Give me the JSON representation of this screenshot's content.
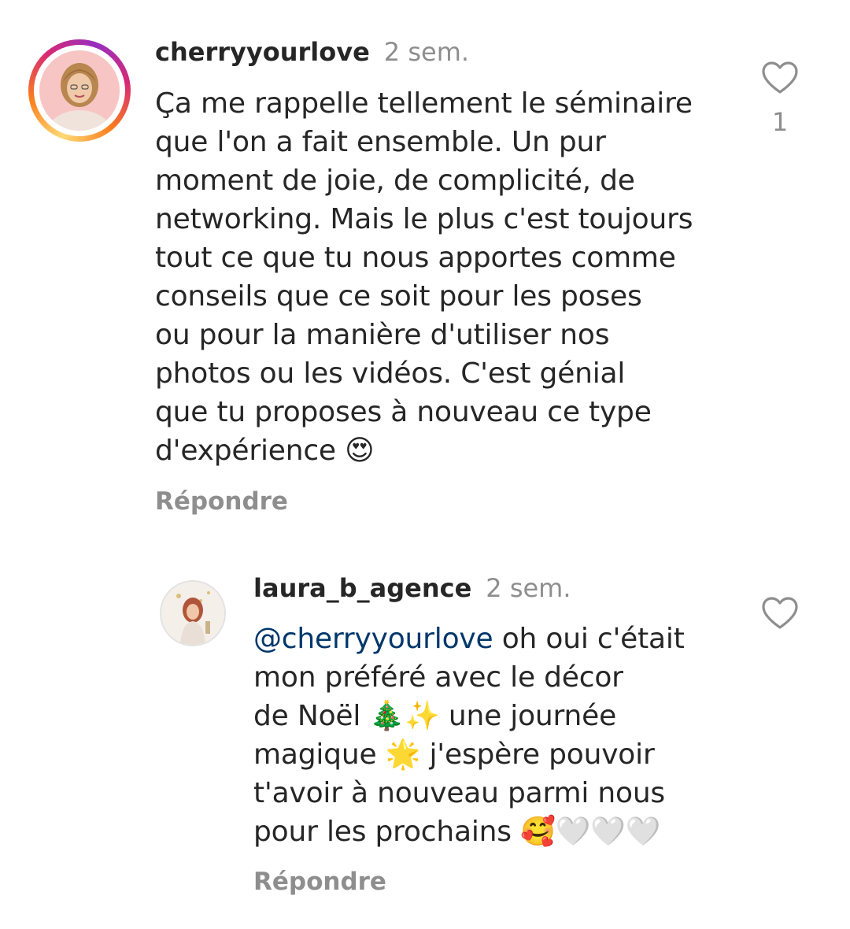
{
  "comments": [
    {
      "username": "cherryyourlove",
      "time": "2 sem.",
      "text": "Ça me rappelle tellement le séminaire\nque l'on a fait ensemble. Un pur\nmoment de joie, de complicité, de\nnetworking. Mais le plus c'est toujours\ntout ce que tu nous apportes comme\nconseils que ce soit pour les poses\nou pour la manière d'utiliser nos\nphotos ou les vidéos. C'est génial\nque tu proposes à nouveau ce type\nd'expérience 😍",
      "reply_label": "Répondre",
      "like_count": "1",
      "like_icon": "heart-outline-icon"
    },
    {
      "username": "laura_b_agence",
      "time": "2 sem.",
      "mention": "@cherryyourlove",
      "text": " oh oui c'était\nmon préféré avec le décor\nde Noël 🎄✨ une journée\nmagique 🌟 j'espère pouvoir\nt'avoir à nouveau parmi nous\npour les prochains 🥰🤍🤍🤍",
      "reply_label": "Répondre",
      "like_icon": "heart-outline-icon"
    }
  ]
}
